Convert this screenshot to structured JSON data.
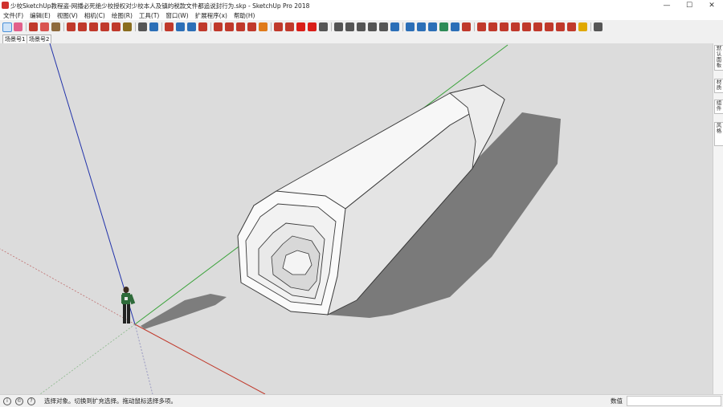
{
  "window": {
    "title": "少校SketchUp教程盗-网播必死绝少校授权对少校本人及镇的税款文件都追说封行为.skp - SketchUp Pro 2018",
    "controls": [
      "—",
      "☐",
      "✕"
    ]
  },
  "menu": [
    "文件(F)",
    "编辑(E)",
    "视图(V)",
    "相机(C)",
    "绘图(R)",
    "工具(T)",
    "窗口(W)",
    "扩展程序(x)",
    "帮助(H)"
  ],
  "toolbar": {
    "buttons": [
      {
        "icon": "select-arrow-icon",
        "color": "#1a1a1a",
        "active": true
      },
      {
        "icon": "eraser-icon",
        "color": "#e25f8a"
      },
      {
        "icon": "pencil-line-icon",
        "color": "#c0392b"
      },
      {
        "icon": "arc-icon",
        "color": "#d9534f"
      },
      {
        "icon": "shape-icon",
        "color": "#8e6b3e"
      },
      {
        "icon": "push-pull-icon",
        "color": "#c0392b"
      },
      {
        "icon": "move-icon",
        "color": "#c0392b"
      },
      {
        "icon": "rotate-icon",
        "color": "#c0392b"
      },
      {
        "icon": "scale-icon",
        "color": "#c0392b"
      },
      {
        "icon": "offset-icon",
        "color": "#c0392b"
      },
      {
        "icon": "tape-measure-icon",
        "color": "#8a6d1e"
      },
      {
        "icon": "text-icon",
        "color": "#555555"
      },
      {
        "icon": "paint-bucket-icon",
        "color": "#2c6fb7"
      },
      {
        "icon": "orbit-icon",
        "color": "#c0392b"
      },
      {
        "icon": "pan-icon",
        "color": "#2c6fb7"
      },
      {
        "icon": "zoom-icon",
        "color": "#2c6fb7"
      },
      {
        "icon": "zoom-extents-icon",
        "color": "#c0392b"
      },
      {
        "icon": "warehouse-icon",
        "color": "#c0392b"
      },
      {
        "icon": "components-icon",
        "color": "#c0392b"
      },
      {
        "icon": "extension-icon",
        "color": "#c0392b"
      },
      {
        "icon": "ruby-icon",
        "color": "#c0392b"
      },
      {
        "icon": "settings-gear-icon",
        "color": "#e07b1a"
      },
      {
        "icon": "model-info-icon",
        "color": "#c0392b"
      },
      {
        "icon": "layout-send-icon",
        "color": "#c0392b"
      },
      {
        "icon": "red-folder-icon",
        "color": "#d91e18"
      },
      {
        "icon": "red-book-icon",
        "color": "#d91e18"
      },
      {
        "icon": "iso-view-icon",
        "color": "#555555"
      },
      {
        "icon": "top-view-icon",
        "color": "#555555"
      },
      {
        "icon": "front-view-icon",
        "color": "#555555"
      },
      {
        "icon": "right-view-icon",
        "color": "#555555"
      },
      {
        "icon": "back-view-icon",
        "color": "#555555"
      },
      {
        "icon": "left-view-icon",
        "color": "#555555"
      },
      {
        "icon": "xray-style-icon",
        "color": "#2c6fb7"
      },
      {
        "icon": "wireframe-style-icon",
        "color": "#2c6fb7"
      },
      {
        "icon": "hidden-line-style-icon",
        "color": "#2c6fb7"
      },
      {
        "icon": "shaded-style-icon",
        "color": "#2c6fb7"
      },
      {
        "icon": "textured-style-icon",
        "color": "#2e8b57"
      },
      {
        "icon": "monochrome-style-icon",
        "color": "#2c6fb7"
      },
      {
        "icon": "sandbox-from-contours-icon",
        "color": "#c0392b"
      },
      {
        "icon": "sandbox-from-scratch-icon",
        "color": "#c0392b"
      },
      {
        "icon": "smoove-icon",
        "color": "#c0392b"
      },
      {
        "icon": "stamp-icon",
        "color": "#c0392b"
      },
      {
        "icon": "drape-icon",
        "color": "#c0392b"
      },
      {
        "icon": "add-detail-icon",
        "color": "#c0392b"
      },
      {
        "icon": "flip-edge-icon",
        "color": "#c0392b"
      },
      {
        "icon": "sandbox-extra-icon",
        "color": "#c0392b"
      },
      {
        "icon": "sandbox-extra-2-icon",
        "color": "#c0392b"
      },
      {
        "icon": "sandbox-extra-3-icon",
        "color": "#c0392b"
      },
      {
        "icon": "sun-icon",
        "color": "#e0a800"
      },
      {
        "icon": "wrench-icon",
        "color": "#555555"
      }
    ]
  },
  "scene_tabs": [
    "场景号1",
    "场景号2"
  ],
  "right_panel_tabs": [
    "默认面板",
    "材质",
    "组件",
    "风格"
  ],
  "status": {
    "message": "选择对象。切换到扩充选择。拖动鼠标选择多项。",
    "icons": [
      "info-icon",
      "credit-icon",
      "help-icon"
    ],
    "measure_label": "数值",
    "measure_value": ""
  },
  "colors": {
    "viewport_bg": "#dcdcdc",
    "axis_red": "#c0392b",
    "axis_green": "#3aa33a",
    "axis_blue": "#2233aa",
    "shadow": "#7a7a7a"
  }
}
